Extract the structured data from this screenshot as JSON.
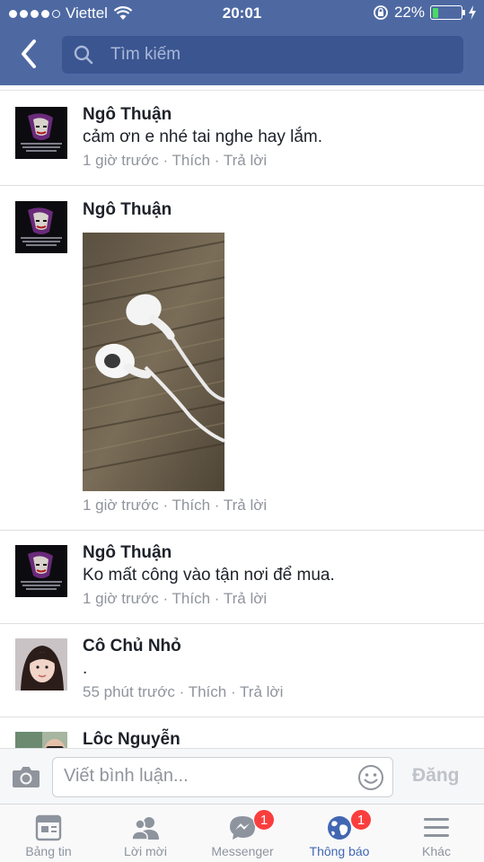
{
  "status_bar": {
    "carrier": "Viettel",
    "time": "20:01",
    "battery": "22%",
    "battery_level": 0.22
  },
  "search": {
    "placeholder": "Tìm kiếm"
  },
  "comments": [
    {
      "author": "Ngô Thuận",
      "text": "cảm ơn e nhé tai nghe hay lắm.",
      "time": "1 giờ trước",
      "like": "Thích",
      "reply": "Trả lời",
      "sep": "·"
    },
    {
      "author": "Ngô Thuận",
      "time": "1 giờ trước",
      "like": "Thích",
      "reply": "Trả lời",
      "sep": "·"
    },
    {
      "author": "Ngô Thuận",
      "text": "Ko mất công vào tận nơi để mua.",
      "time": "1 giờ trước",
      "like": "Thích",
      "reply": "Trả lời",
      "sep": "·"
    },
    {
      "author": "Cô Chủ Nhỏ",
      "text": ".",
      "time": "55 phút trước",
      "like": "Thích",
      "reply": "Trả lời",
      "sep": "·"
    },
    {
      "author": "Lôc Nguyễn"
    }
  ],
  "composer": {
    "placeholder": "Viết bình luận...",
    "post_label": "Đăng"
  },
  "tabbar": {
    "tabs": [
      {
        "label": "Bảng tin"
      },
      {
        "label": "Lời mời"
      },
      {
        "label": "Messenger",
        "badge": "1"
      },
      {
        "label": "Thông báo",
        "badge": "1"
      },
      {
        "label": "Khác"
      }
    ]
  },
  "colors": {
    "header": "#4e69a2",
    "accent": "#4267b2",
    "badge": "#fa3e3e",
    "battery": "#4cd964"
  }
}
